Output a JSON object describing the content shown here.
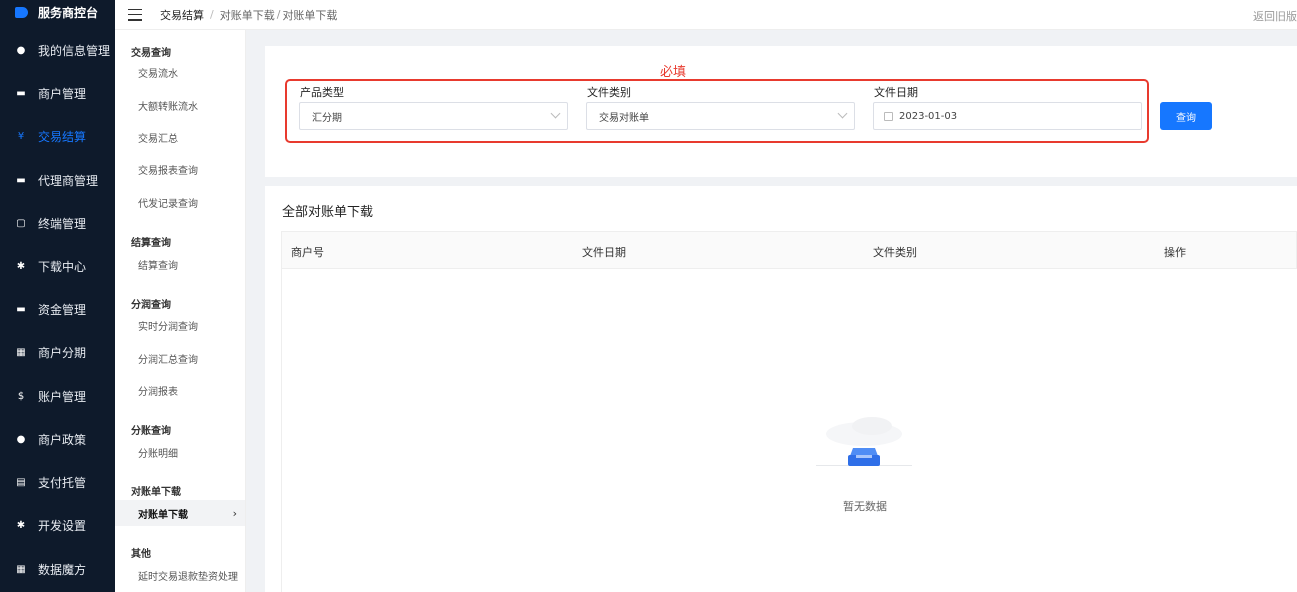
{
  "brand": "服务商控台",
  "nav": [
    {
      "label": "我的信息管理",
      "icon": "user-icon",
      "glyph": "●"
    },
    {
      "label": "商户管理",
      "icon": "store-icon",
      "glyph": "▬"
    },
    {
      "label": "交易结算",
      "icon": "yen-icon",
      "glyph": "¥"
    },
    {
      "label": "代理商管理",
      "icon": "agent-icon",
      "glyph": "▬"
    },
    {
      "label": "终端管理",
      "icon": "terminal-icon",
      "glyph": "▢"
    },
    {
      "label": "下载中心",
      "icon": "download-icon",
      "glyph": "✱"
    },
    {
      "label": "资金管理",
      "icon": "fund-icon",
      "glyph": "▬"
    },
    {
      "label": "商户分期",
      "icon": "installment-icon",
      "glyph": "▦"
    },
    {
      "label": "账户管理",
      "icon": "account-icon",
      "glyph": "$"
    },
    {
      "label": "商户政策",
      "icon": "policy-icon",
      "glyph": "●"
    },
    {
      "label": "支付托管",
      "icon": "custody-icon",
      "glyph": "▤"
    },
    {
      "label": "开发设置",
      "icon": "settings-icon",
      "glyph": "✱"
    },
    {
      "label": "数据魔方",
      "icon": "data-icon",
      "glyph": "▦"
    }
  ],
  "nav_active_index": 2,
  "breadcrumb": {
    "root": "交易结算",
    "sep": "/",
    "mid": "对账单下载",
    "sep2": "/",
    "leaf": "对账单下载"
  },
  "back_old": "返回旧版",
  "submenu": {
    "groups": [
      {
        "title": "交易查询",
        "items": [
          "交易流水",
          "大额转账流水",
          "交易汇总",
          "交易报表查询",
          "代发记录查询"
        ]
      },
      {
        "title": "结算查询",
        "items": [
          "结算查询"
        ]
      },
      {
        "title": "分润查询",
        "items": [
          "实时分润查询",
          "分润汇总查询",
          "分润报表"
        ]
      },
      {
        "title": "分账查询",
        "items": [
          "分账明细"
        ]
      },
      {
        "title": "对账单下载",
        "items": [
          "对账单下载"
        ]
      },
      {
        "title": "其他",
        "items": [
          "延时交易退款垫资处理"
        ]
      }
    ],
    "active_item": "对账单下载"
  },
  "filters": {
    "required_note": "必填",
    "product_type": {
      "label": "产品类型",
      "value": "汇分期"
    },
    "file_category": {
      "label": "文件类别",
      "value": "交易对账单"
    },
    "file_date": {
      "label": "文件日期",
      "value": "2023-01-03"
    },
    "query_button": "查询"
  },
  "table": {
    "title": "全部对账单下载",
    "columns": [
      "商户号",
      "文件日期",
      "文件类别",
      "操作"
    ],
    "empty_text": "暂无数据"
  },
  "colors": {
    "accent": "#1677ff",
    "sidebar_bg": "#0e1a2b",
    "highlight_red": "#e83a2e"
  }
}
